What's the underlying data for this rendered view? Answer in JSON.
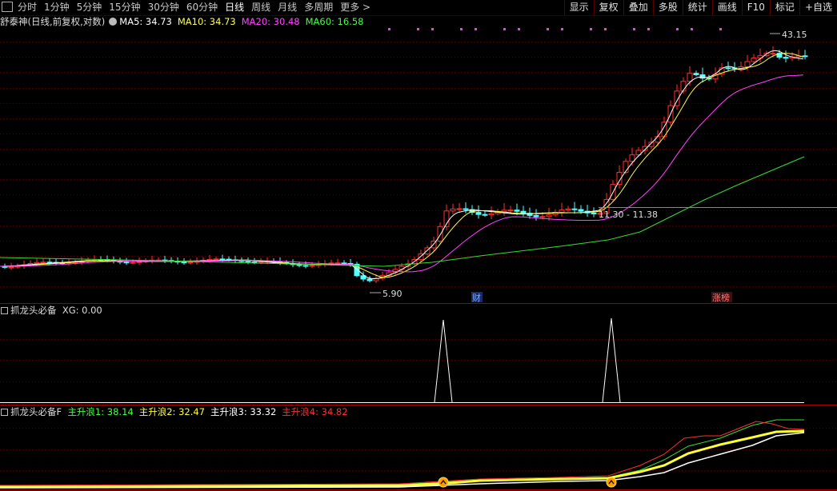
{
  "toolbar": {
    "periods": [
      "分时",
      "1分钟",
      "5分钟",
      "15分钟",
      "30分钟",
      "60分钟",
      "日线",
      "周线",
      "月线",
      "多周期",
      "更多 >"
    ],
    "active_period": "日线",
    "right_buttons": [
      "显示",
      "复权",
      "叠加",
      "多股",
      "统计",
      "画线",
      "F10",
      "标记",
      "+自选"
    ]
  },
  "main_panel": {
    "stock_label": "舒泰神(日线,前复权,对数)",
    "ma_values": [
      {
        "label": "MA5: 34.73",
        "color": "#ffffff"
      },
      {
        "label": "MA10: 34.73",
        "color": "#ffff55"
      },
      {
        "label": "MA20: 30.48",
        "color": "#ff44ff"
      },
      {
        "label": "MA60: 16.58",
        "color": "#44ff44"
      }
    ],
    "high_label": "43.15",
    "low_label": "5.90",
    "range_label": "11.30 - 11.38",
    "event_labels": [
      "财",
      "涨榜"
    ],
    "colors": {
      "up": "#ff3030",
      "down": "#54ffff",
      "grid": "#550000"
    }
  },
  "indicator1": {
    "title": "抓龙头必备",
    "value": "XG: 0.00"
  },
  "indicator2": {
    "title": "抓龙头必备F",
    "values": [
      {
        "label": "主升浪1: 38.14",
        "color": "#44ff44"
      },
      {
        "label": "主升浪2: 32.47",
        "color": "#ffff33"
      },
      {
        "label": "主升浪3: 33.32",
        "color": "#ffffff"
      },
      {
        "label": "主升浪4: 34.82",
        "color": "#ff3030"
      }
    ]
  },
  "chart_data": {
    "type": "candlestick",
    "price_high": 43.15,
    "price_low": 5.9,
    "ma_latest": {
      "MA5": 34.73,
      "MA10": 34.73,
      "MA20": 30.48,
      "MA60": 16.58
    }
  }
}
